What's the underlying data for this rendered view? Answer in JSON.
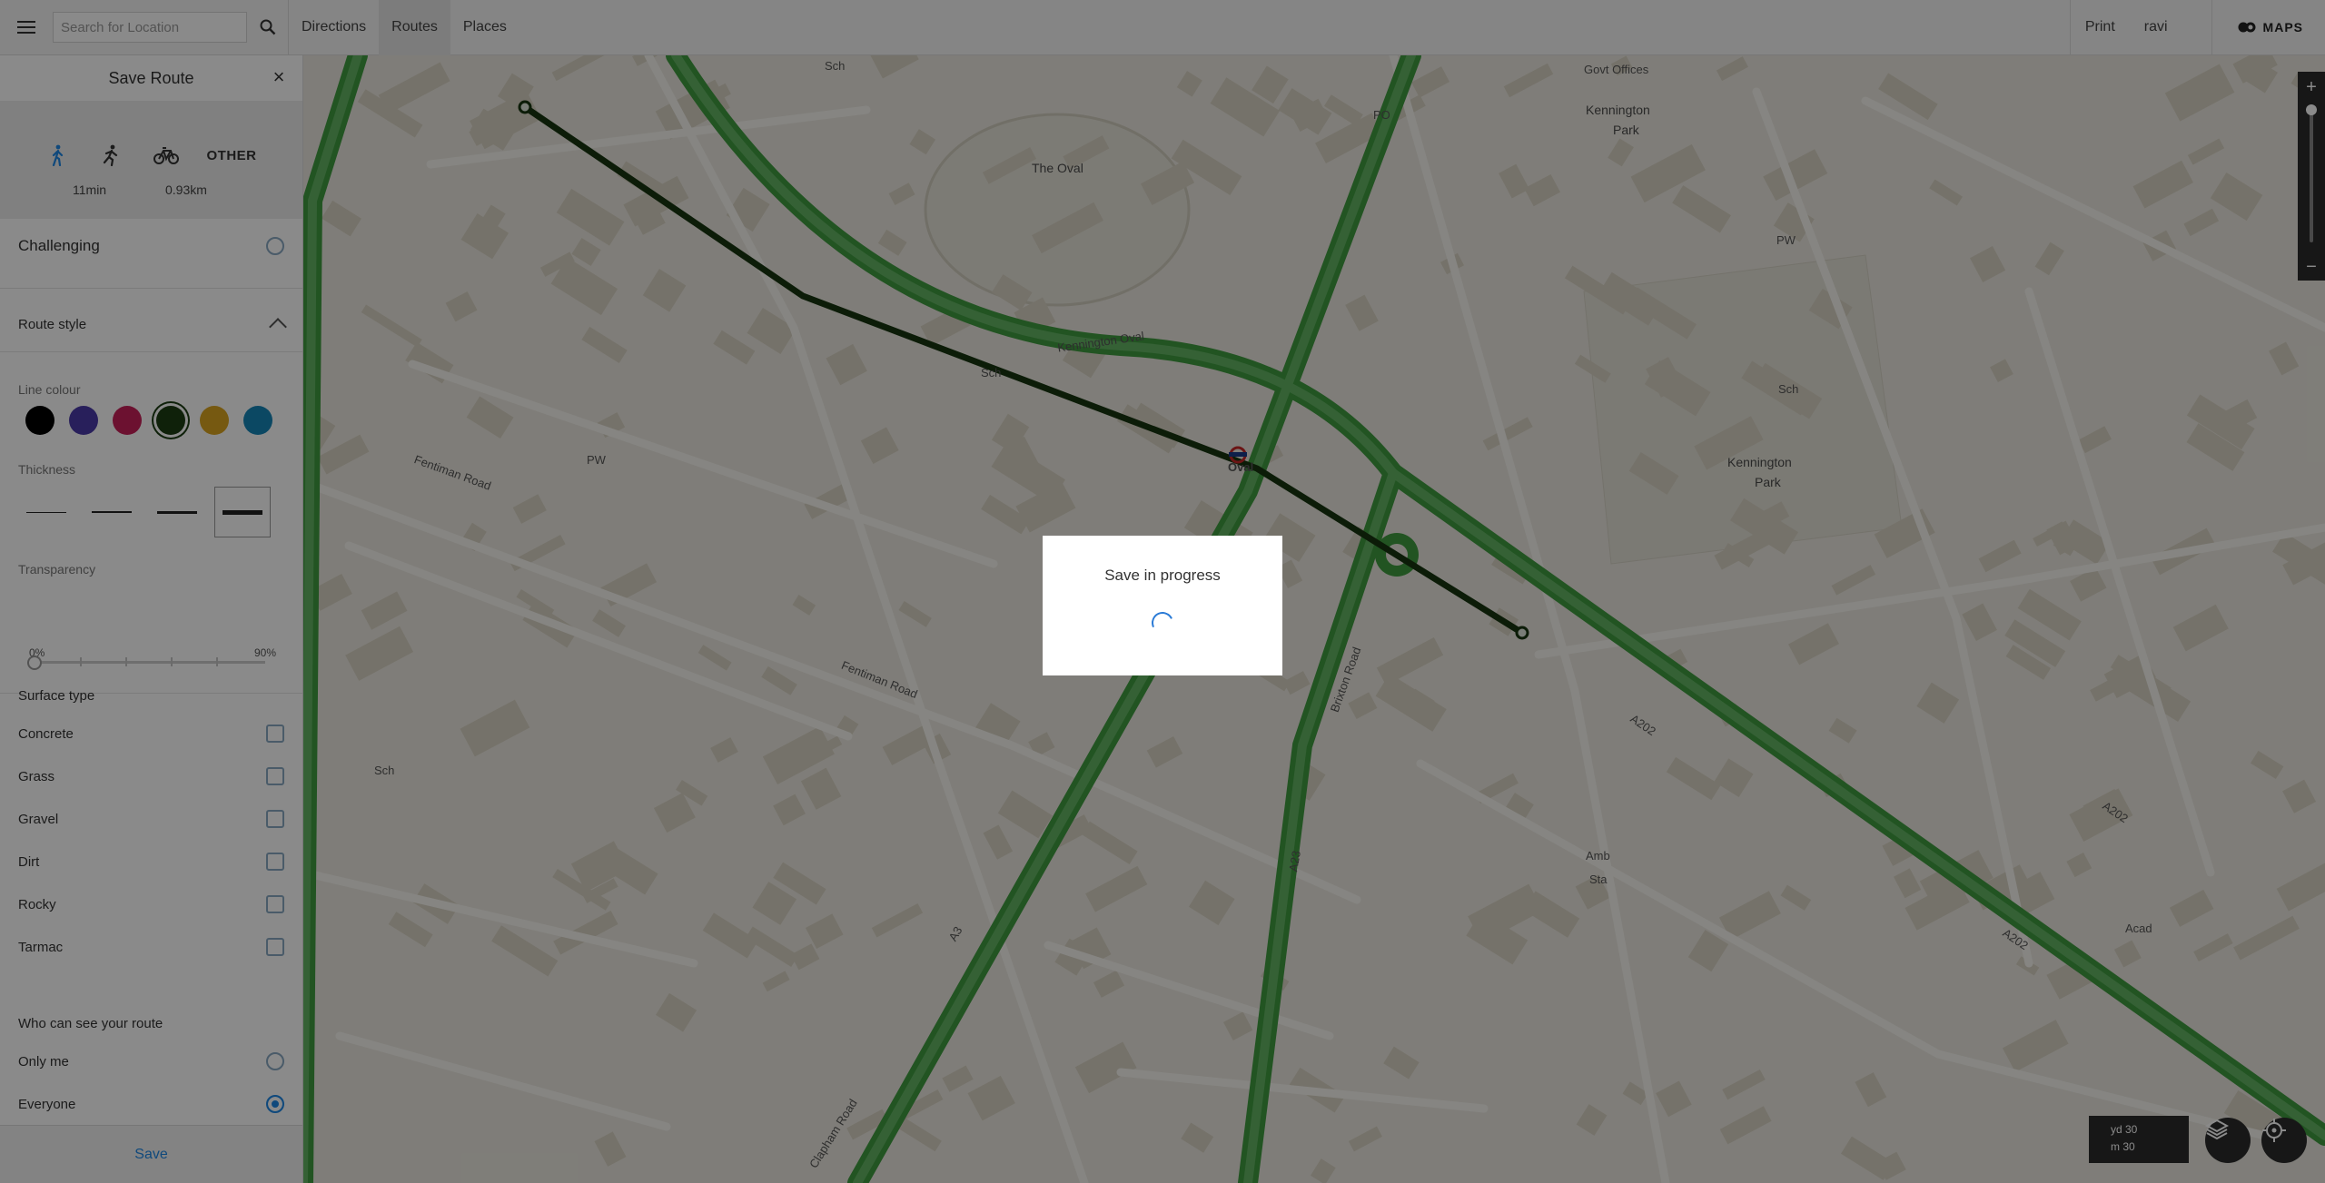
{
  "topbar": {
    "search_placeholder": "Search for Location",
    "nav": [
      "Directions",
      "Routes",
      "Places"
    ],
    "active_tab": "Routes",
    "print": "Print",
    "user": "ravi",
    "brand": "MAPS",
    "icons": {
      "menu": "hamburger-icon",
      "search": "search-icon",
      "brand": "os-logo-icon"
    }
  },
  "sidebar": {
    "title": "Save Route",
    "modes": {
      "walk_icon": "walk-icon",
      "run_icon": "run-icon",
      "cycle_icon": "bicycle-icon",
      "other": "OTHER",
      "selected": "walk"
    },
    "stats": {
      "time": "11min",
      "distance": "0.93km"
    },
    "difficulty": {
      "label": "Challenging"
    },
    "route_style": {
      "title": "Route style",
      "line_colour_label": "Line colour",
      "colours": [
        "#000000",
        "#4a3aa8",
        "#c8205a",
        "#1c3d14",
        "#dba520",
        "#1685b8"
      ],
      "selected_colour": "#1c3d14",
      "thickness_label": "Thickness",
      "thickness_selected": 4,
      "transparency_label": "Transparency",
      "transparency_min": "0%",
      "transparency_max": "90%",
      "transparency_value": 0
    },
    "surface": {
      "title": "Surface type",
      "items": [
        "Concrete",
        "Grass",
        "Gravel",
        "Dirt",
        "Rocky",
        "Tarmac"
      ]
    },
    "visibility": {
      "title": "Who can see your route",
      "options": [
        "Only me",
        "Everyone"
      ],
      "selected": "Everyone"
    },
    "save_label": "Save"
  },
  "map": {
    "labels": [
      {
        "t": "Govt Offices",
        "big": false
      },
      {
        "t": "Kennington",
        "big": true
      },
      {
        "t": "Park",
        "big": true
      },
      {
        "t": "The Oval",
        "big": true
      },
      {
        "t": "Kennington Oval",
        "big": false
      },
      {
        "t": "Oval",
        "big": false
      },
      {
        "t": "Kennington",
        "big": true
      },
      {
        "t": "Park",
        "big": true
      },
      {
        "t": "Fentiman Road",
        "big": false
      },
      {
        "t": "Fentiman Road",
        "big": false
      },
      {
        "t": "Brixton Road",
        "big": false
      },
      {
        "t": "Clapham Road",
        "big": false
      },
      {
        "t": "A202",
        "big": false
      },
      {
        "t": "A202",
        "big": false
      },
      {
        "t": "A202",
        "big": false
      },
      {
        "t": "A3",
        "big": false
      },
      {
        "t": "A23",
        "big": false
      },
      {
        "t": "Sch",
        "big": false
      },
      {
        "t": "Sch",
        "big": false
      },
      {
        "t": "Sch",
        "big": false
      },
      {
        "t": "Sch",
        "big": false
      },
      {
        "t": "PW",
        "big": false
      },
      {
        "t": "PW",
        "big": false
      },
      {
        "t": "PO",
        "big": false
      },
      {
        "t": "Acad",
        "big": false
      },
      {
        "t": "Amb",
        "big": false
      },
      {
        "t": "Sta",
        "big": false
      }
    ],
    "scale": {
      "yd": "yd  30",
      "m": "m   30"
    },
    "zoom_in": "+",
    "zoom_out": "−",
    "icons": {
      "layers": "layers-icon",
      "locate": "crosshair-icon"
    }
  },
  "modal": {
    "text": "Save in progress"
  }
}
